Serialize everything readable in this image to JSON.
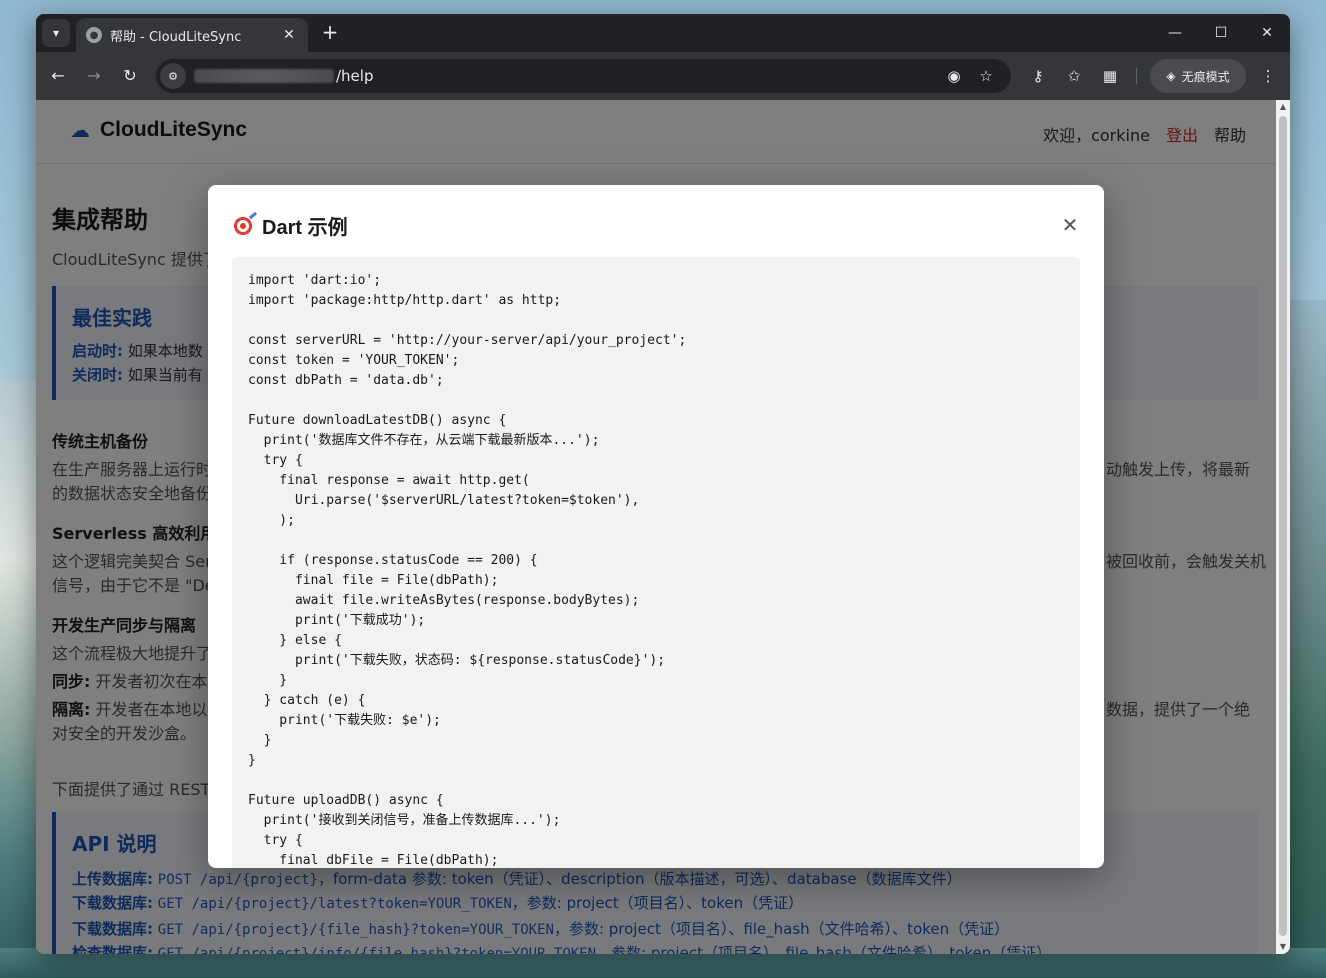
{
  "browser": {
    "tab_title": "帮助 - CloudLiteSync",
    "url_path": "/help",
    "incognito_label": "无痕模式"
  },
  "page": {
    "brand": "CloudLiteSync",
    "nav": {
      "welcome": "欢迎，corkine",
      "logout": "登出",
      "help": "帮助"
    },
    "title": "集成帮助",
    "intro": "CloudLiteSync 提供了",
    "best_practice": {
      "title": "最佳实践",
      "startup_label": "启动时:",
      "startup_text": "如果本地数",
      "shutdown_label": "关闭时:",
      "shutdown_text": "如果当前有"
    },
    "sections": {
      "traditional_title": "传统主机备份",
      "traditional_line1_left": "在生产服务器上运行时",
      "traditional_line1_right": "动触发上传，将最新",
      "traditional_line2": "的数据状态安全地备份",
      "serverless_title": "Serverless 高效利用",
      "serverless_line1_left": "这个逻辑完美契合 Ser",
      "serverless_line1_right": "被回收前，会触发关机",
      "serverless_line2": "信号，由于它不是 \"De",
      "devprod_title": "开发生产同步与隔离",
      "devprod_line1": "这个流程极大地提升了",
      "sync_label": "同步:",
      "sync_text": "开发者初次在本",
      "isolate_label": "隔离:",
      "isolate_text": "开发者在本地以",
      "isolate_right": "数据，提供了一个绝",
      "isolate_line2": "对安全的开发沙盒。",
      "rest_line": "下面提供了通过 REST"
    },
    "api": {
      "title": "API 说明",
      "lines": [
        {
          "label": "上传数据库:",
          "code": "POST /api/{project}",
          "text": "，form-data 参数: token（凭证）、description（版本描述，可选）、database（数据库文件）"
        },
        {
          "label": "下载数据库:",
          "code": "GET /api/{project}/latest?token=YOUR_TOKEN",
          "text": "，参数: project（项目名）、token（凭证）"
        },
        {
          "label": "下载数据库:",
          "code": "GET /api/{project}/{file_hash}?token=YOUR_TOKEN",
          "text": "，参数: project（项目名）、file_hash（文件哈希）、token（凭证）"
        },
        {
          "label": "检查数据库:",
          "code": "GET /api/{project}/info/{file_hash}?token=YOUR_TOKEN",
          "text": "，参数: project（项目名）、file_hash（文件哈希）、token（凭证）"
        }
      ]
    }
  },
  "modal": {
    "title": "Dart 示例",
    "code": "import 'dart:io';\nimport 'package:http/http.dart' as http;\n\nconst serverURL = 'http://your-server/api/your_project';\nconst token = 'YOUR_TOKEN';\nconst dbPath = 'data.db';\n\nFuture downloadLatestDB() async {\n  print('数据库文件不存在，从云端下载最新版本...');\n  try {\n    final response = await http.get(\n      Uri.parse('$serverURL/latest?token=$token'),\n    );\n\n    if (response.statusCode == 200) {\n      final file = File(dbPath);\n      await file.writeAsBytes(response.bodyBytes);\n      print('下载成功');\n    } else {\n      print('下载失败，状态码: ${response.statusCode}');\n    }\n  } catch (e) {\n    print('下载失败: $e');\n  }\n}\n\nFuture uploadDB() async {\n  print('接收到关闭信号，准备上传数据库...');\n  try {\n    final dbFile = File(dbPath);"
  }
}
